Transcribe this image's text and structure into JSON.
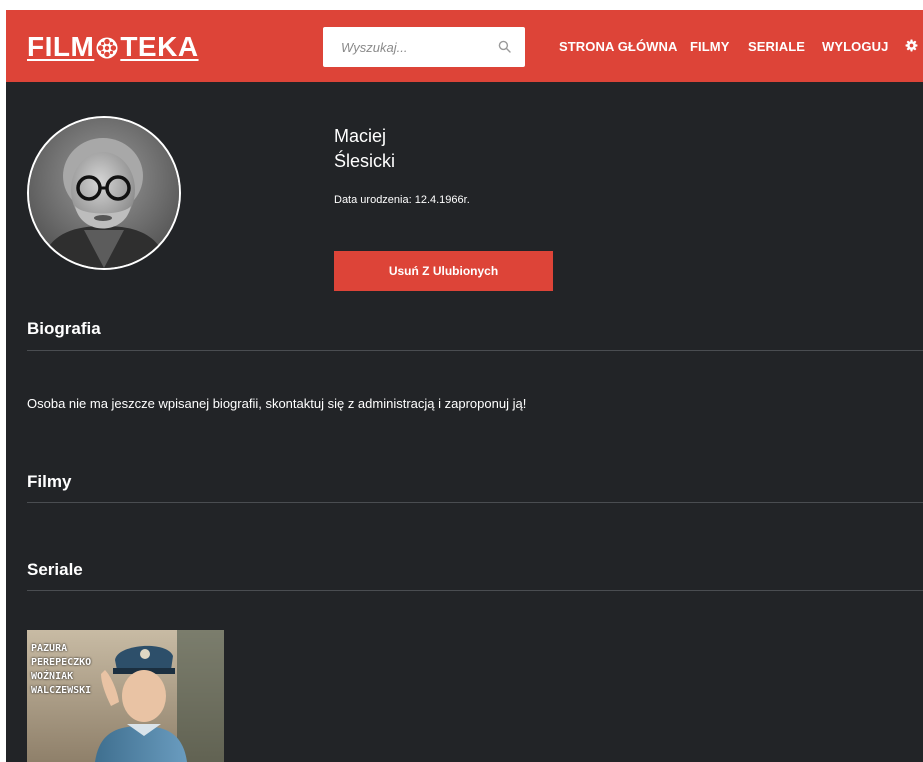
{
  "header": {
    "logo_text_left": "FILM",
    "logo_text_right": "TEKA",
    "search_placeholder": "Wyszukaj...",
    "nav": [
      "STRONA GŁÓWNA",
      "FILMY",
      "SERIALE",
      "WYLOGUJ"
    ],
    "colors": {
      "bar": "#dd4438",
      "background": "#222427"
    }
  },
  "person": {
    "first_name": "Maciej",
    "last_name": "Ślesicki",
    "birth_date": "Data urodzenia: 12.4.1966r.",
    "favorite_button": "Usuń Z Ulubionych"
  },
  "sections": {
    "bio_title": "Biografia",
    "bio_text": "Osoba nie ma jeszcze wpisanej biografii, skontaktuj się z administracją i zaproponuj ją!",
    "films_title": "Filmy",
    "series_title": "Seriale"
  },
  "series_poster": {
    "credits": [
      "PAZURA",
      "PEREPECZKO",
      "WOŹNIAK",
      "WALCZEWSKI"
    ]
  },
  "icons": {
    "search": "search-icon",
    "settings": "gear-icon",
    "logo_reel": "film-reel-icon"
  }
}
